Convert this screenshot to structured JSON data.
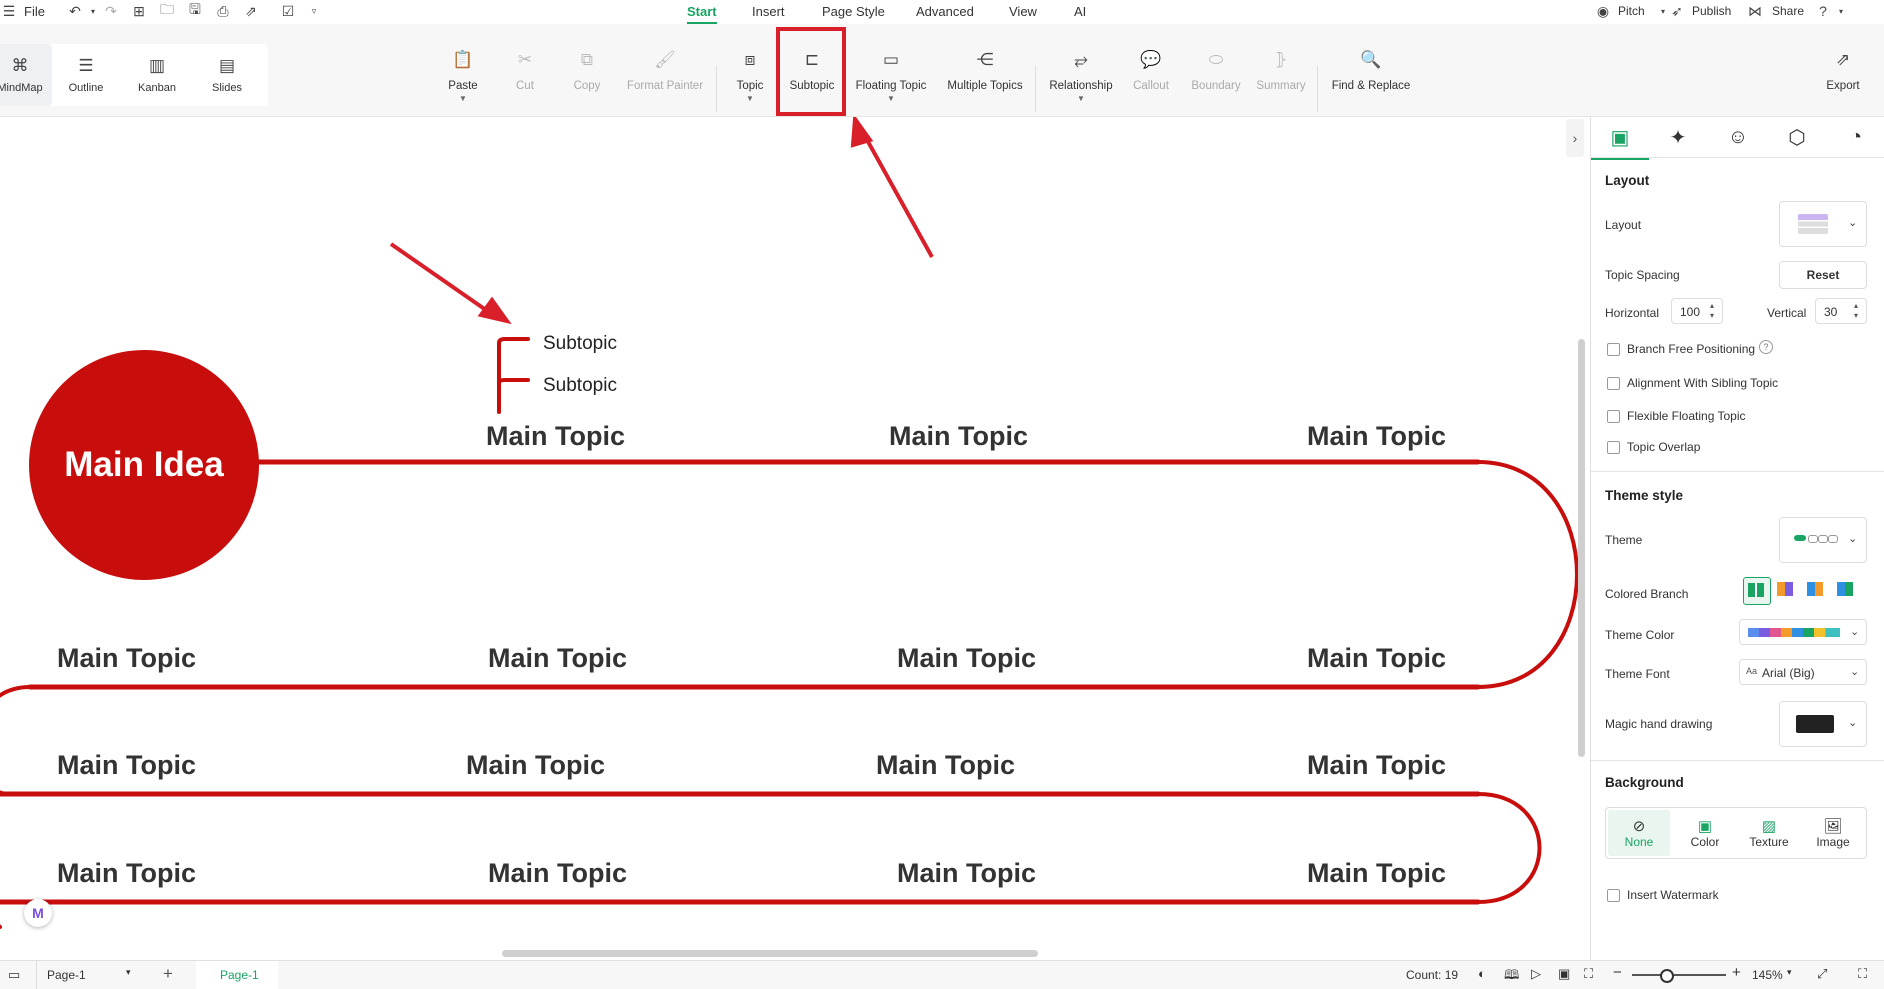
{
  "menu": {
    "file": "File",
    "tabs": [
      "Start",
      "Insert",
      "Page Style",
      "Advanced",
      "View",
      "AI"
    ],
    "active_tab": "Start",
    "right": {
      "pitch": "Pitch",
      "publish": "Publish",
      "share": "Share"
    }
  },
  "views": {
    "mindmap": "MindMap",
    "outline": "Outline",
    "kanban": "Kanban",
    "slides": "Slides"
  },
  "toolbar": {
    "paste": "Paste",
    "cut": "Cut",
    "copy": "Copy",
    "format_painter": "Format Painter",
    "topic": "Topic",
    "subtopic": "Subtopic",
    "floating_topic": "Floating Topic",
    "multiple_topics": "Multiple Topics",
    "relationship": "Relationship",
    "callout": "Callout",
    "boundary": "Boundary",
    "summary": "Summary",
    "find_replace": "Find & Replace",
    "export": "Export"
  },
  "canvas": {
    "main_idea": "Main Idea",
    "subtopics": [
      "Subtopic",
      "Subtopic"
    ],
    "row1": [
      "Main Topic",
      "Main Topic",
      "Main Topic"
    ],
    "row2": [
      "Main Topic",
      "Main Topic",
      "Main Topic",
      "Main Topic"
    ],
    "row3": [
      "Main Topic",
      "Main Topic",
      "Main Topic",
      "Main Topic"
    ],
    "row4": [
      "Main Topic",
      "Main Topic",
      "Main Topic",
      "Main Topic"
    ],
    "branch_color": "#c80d0d",
    "annotation_color": "#d91f2a"
  },
  "panel": {
    "layout_header": "Layout",
    "layout_label": "Layout",
    "topic_spacing": "Topic Spacing",
    "reset": "Reset",
    "horizontal_label": "Horizontal",
    "horizontal_value": "100",
    "vertical_label": "Vertical",
    "vertical_value": "30",
    "checks": [
      "Branch Free Positioning",
      "Alignment With Sibling Topic",
      "Flexible Floating Topic",
      "Topic Overlap"
    ],
    "theme_style_header": "Theme style",
    "theme": "Theme",
    "colored_branch": "Colored Branch",
    "theme_color": "Theme Color",
    "theme_font": "Theme Font",
    "theme_font_value": "Arial (Big)",
    "magic_hand": "Magic hand drawing",
    "background_header": "Background",
    "bg_options": [
      "None",
      "Color",
      "Texture",
      "Image"
    ],
    "insert_watermark": "Insert Watermark"
  },
  "status": {
    "page_select": "Page-1",
    "page_tab": "Page-1",
    "count": "Count: 19",
    "zoom": "145%"
  }
}
